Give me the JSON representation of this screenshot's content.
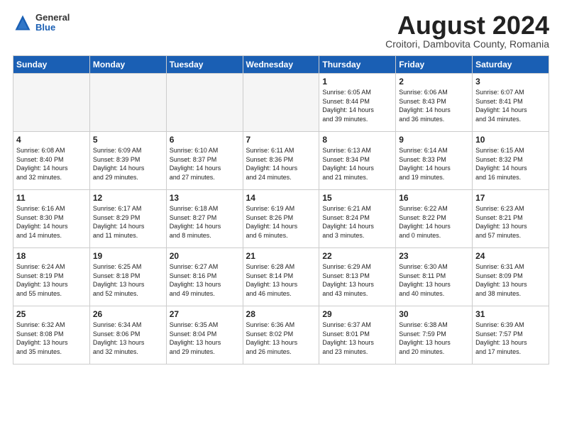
{
  "header": {
    "logo": {
      "general": "General",
      "blue": "Blue"
    },
    "title": "August 2024",
    "location": "Croitori, Dambovita County, Romania"
  },
  "weekdays": [
    "Sunday",
    "Monday",
    "Tuesday",
    "Wednesday",
    "Thursday",
    "Friday",
    "Saturday"
  ],
  "weeks": [
    [
      {
        "day": "",
        "info": ""
      },
      {
        "day": "",
        "info": ""
      },
      {
        "day": "",
        "info": ""
      },
      {
        "day": "",
        "info": ""
      },
      {
        "day": "1",
        "info": "Sunrise: 6:05 AM\nSunset: 8:44 PM\nDaylight: 14 hours\nand 39 minutes."
      },
      {
        "day": "2",
        "info": "Sunrise: 6:06 AM\nSunset: 8:43 PM\nDaylight: 14 hours\nand 36 minutes."
      },
      {
        "day": "3",
        "info": "Sunrise: 6:07 AM\nSunset: 8:41 PM\nDaylight: 14 hours\nand 34 minutes."
      }
    ],
    [
      {
        "day": "4",
        "info": "Sunrise: 6:08 AM\nSunset: 8:40 PM\nDaylight: 14 hours\nand 32 minutes."
      },
      {
        "day": "5",
        "info": "Sunrise: 6:09 AM\nSunset: 8:39 PM\nDaylight: 14 hours\nand 29 minutes."
      },
      {
        "day": "6",
        "info": "Sunrise: 6:10 AM\nSunset: 8:37 PM\nDaylight: 14 hours\nand 27 minutes."
      },
      {
        "day": "7",
        "info": "Sunrise: 6:11 AM\nSunset: 8:36 PM\nDaylight: 14 hours\nand 24 minutes."
      },
      {
        "day": "8",
        "info": "Sunrise: 6:13 AM\nSunset: 8:34 PM\nDaylight: 14 hours\nand 21 minutes."
      },
      {
        "day": "9",
        "info": "Sunrise: 6:14 AM\nSunset: 8:33 PM\nDaylight: 14 hours\nand 19 minutes."
      },
      {
        "day": "10",
        "info": "Sunrise: 6:15 AM\nSunset: 8:32 PM\nDaylight: 14 hours\nand 16 minutes."
      }
    ],
    [
      {
        "day": "11",
        "info": "Sunrise: 6:16 AM\nSunset: 8:30 PM\nDaylight: 14 hours\nand 14 minutes."
      },
      {
        "day": "12",
        "info": "Sunrise: 6:17 AM\nSunset: 8:29 PM\nDaylight: 14 hours\nand 11 minutes."
      },
      {
        "day": "13",
        "info": "Sunrise: 6:18 AM\nSunset: 8:27 PM\nDaylight: 14 hours\nand 8 minutes."
      },
      {
        "day": "14",
        "info": "Sunrise: 6:19 AM\nSunset: 8:26 PM\nDaylight: 14 hours\nand 6 minutes."
      },
      {
        "day": "15",
        "info": "Sunrise: 6:21 AM\nSunset: 8:24 PM\nDaylight: 14 hours\nand 3 minutes."
      },
      {
        "day": "16",
        "info": "Sunrise: 6:22 AM\nSunset: 8:22 PM\nDaylight: 14 hours\nand 0 minutes."
      },
      {
        "day": "17",
        "info": "Sunrise: 6:23 AM\nSunset: 8:21 PM\nDaylight: 13 hours\nand 57 minutes."
      }
    ],
    [
      {
        "day": "18",
        "info": "Sunrise: 6:24 AM\nSunset: 8:19 PM\nDaylight: 13 hours\nand 55 minutes."
      },
      {
        "day": "19",
        "info": "Sunrise: 6:25 AM\nSunset: 8:18 PM\nDaylight: 13 hours\nand 52 minutes."
      },
      {
        "day": "20",
        "info": "Sunrise: 6:27 AM\nSunset: 8:16 PM\nDaylight: 13 hours\nand 49 minutes."
      },
      {
        "day": "21",
        "info": "Sunrise: 6:28 AM\nSunset: 8:14 PM\nDaylight: 13 hours\nand 46 minutes."
      },
      {
        "day": "22",
        "info": "Sunrise: 6:29 AM\nSunset: 8:13 PM\nDaylight: 13 hours\nand 43 minutes."
      },
      {
        "day": "23",
        "info": "Sunrise: 6:30 AM\nSunset: 8:11 PM\nDaylight: 13 hours\nand 40 minutes."
      },
      {
        "day": "24",
        "info": "Sunrise: 6:31 AM\nSunset: 8:09 PM\nDaylight: 13 hours\nand 38 minutes."
      }
    ],
    [
      {
        "day": "25",
        "info": "Sunrise: 6:32 AM\nSunset: 8:08 PM\nDaylight: 13 hours\nand 35 minutes."
      },
      {
        "day": "26",
        "info": "Sunrise: 6:34 AM\nSunset: 8:06 PM\nDaylight: 13 hours\nand 32 minutes."
      },
      {
        "day": "27",
        "info": "Sunrise: 6:35 AM\nSunset: 8:04 PM\nDaylight: 13 hours\nand 29 minutes."
      },
      {
        "day": "28",
        "info": "Sunrise: 6:36 AM\nSunset: 8:02 PM\nDaylight: 13 hours\nand 26 minutes."
      },
      {
        "day": "29",
        "info": "Sunrise: 6:37 AM\nSunset: 8:01 PM\nDaylight: 13 hours\nand 23 minutes."
      },
      {
        "day": "30",
        "info": "Sunrise: 6:38 AM\nSunset: 7:59 PM\nDaylight: 13 hours\nand 20 minutes."
      },
      {
        "day": "31",
        "info": "Sunrise: 6:39 AM\nSunset: 7:57 PM\nDaylight: 13 hours\nand 17 minutes."
      }
    ]
  ]
}
